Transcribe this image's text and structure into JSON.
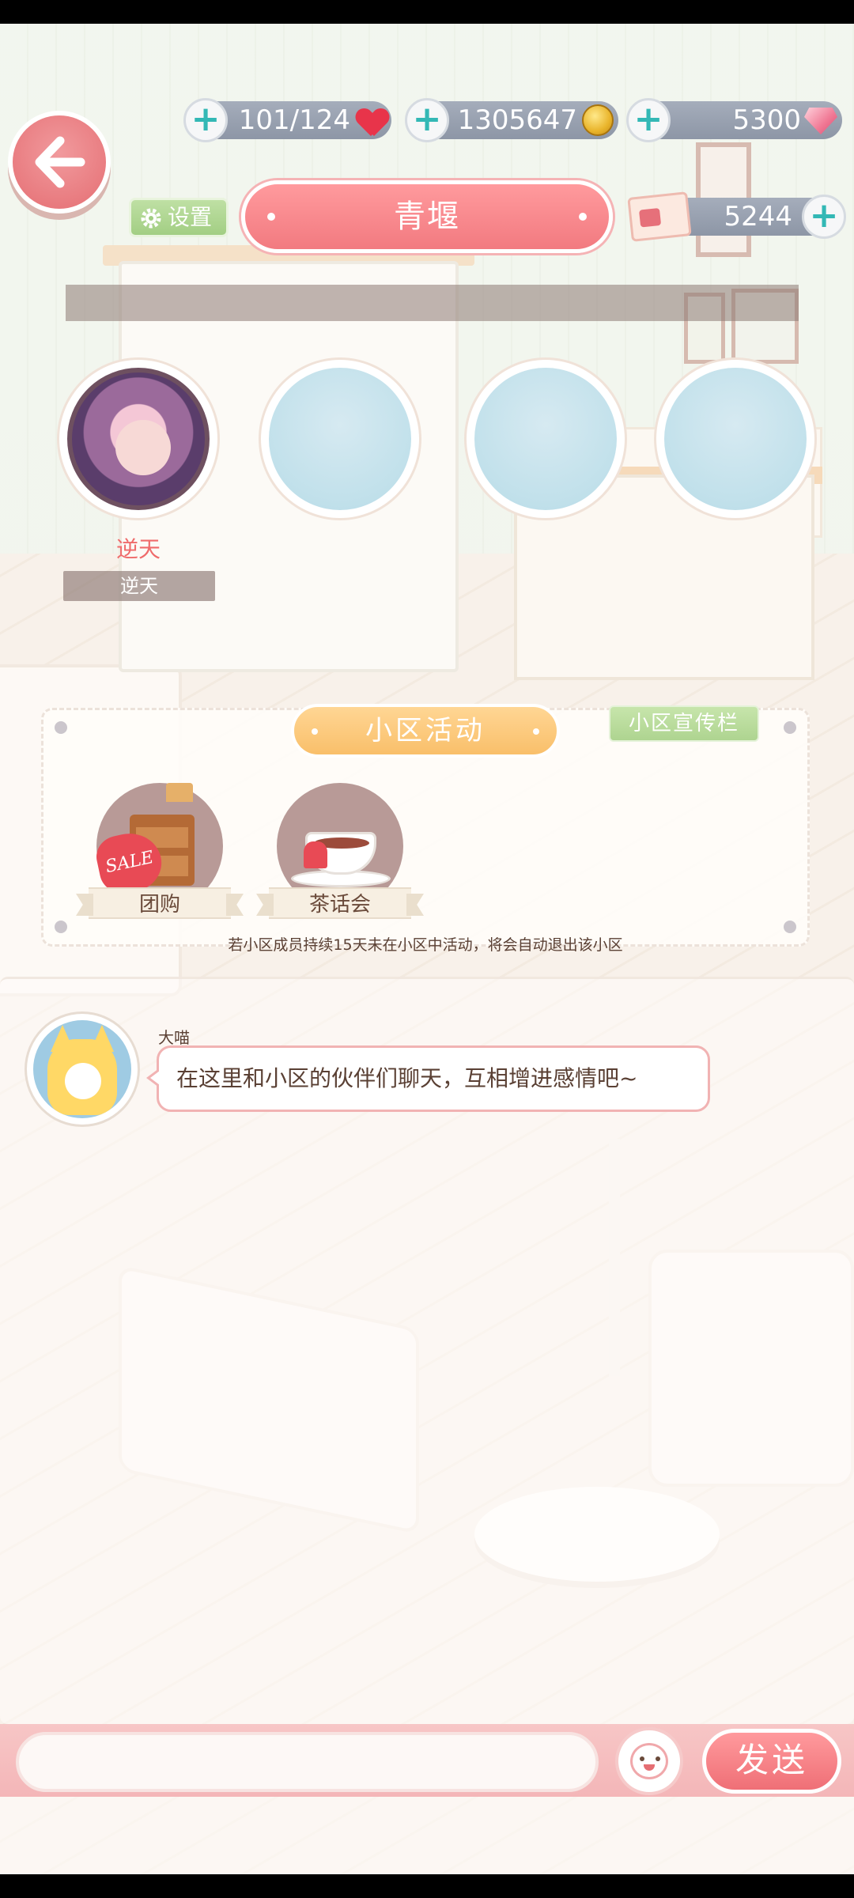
{
  "resources": {
    "stamina": "101/124",
    "coins": "1305647",
    "gems": "5300",
    "tickets": "5244"
  },
  "header": {
    "settings_label": "设置",
    "community_name": "青堰"
  },
  "members": [
    {
      "name": "逆天",
      "tag": "逆天"
    }
  ],
  "activities": {
    "title": "小区活动",
    "board_button": "小区宣传栏",
    "items": [
      {
        "label": "团购",
        "badge": "SALE"
      },
      {
        "label": "茶话会"
      }
    ],
    "note": "若小区成员持续15天未在小区中活动，将会自动退出该小区"
  },
  "chat": {
    "messages": [
      {
        "sender": "大喵",
        "text": "在这里和小区的伙伴们聊天，互相增进感情吧~"
      }
    ],
    "input_value": "",
    "send_label": "发送"
  },
  "colors": {
    "accent_pink": "#f27a80",
    "accent_orange": "#f9bf6a",
    "accent_green": "#a2ce83",
    "plus_teal": "#33b8b5"
  },
  "icons": [
    "back-arrow-icon",
    "plus-icon",
    "heart-icon",
    "coin-icon",
    "gem-icon",
    "gear-icon",
    "ticket-icon",
    "emoji-icon"
  ]
}
